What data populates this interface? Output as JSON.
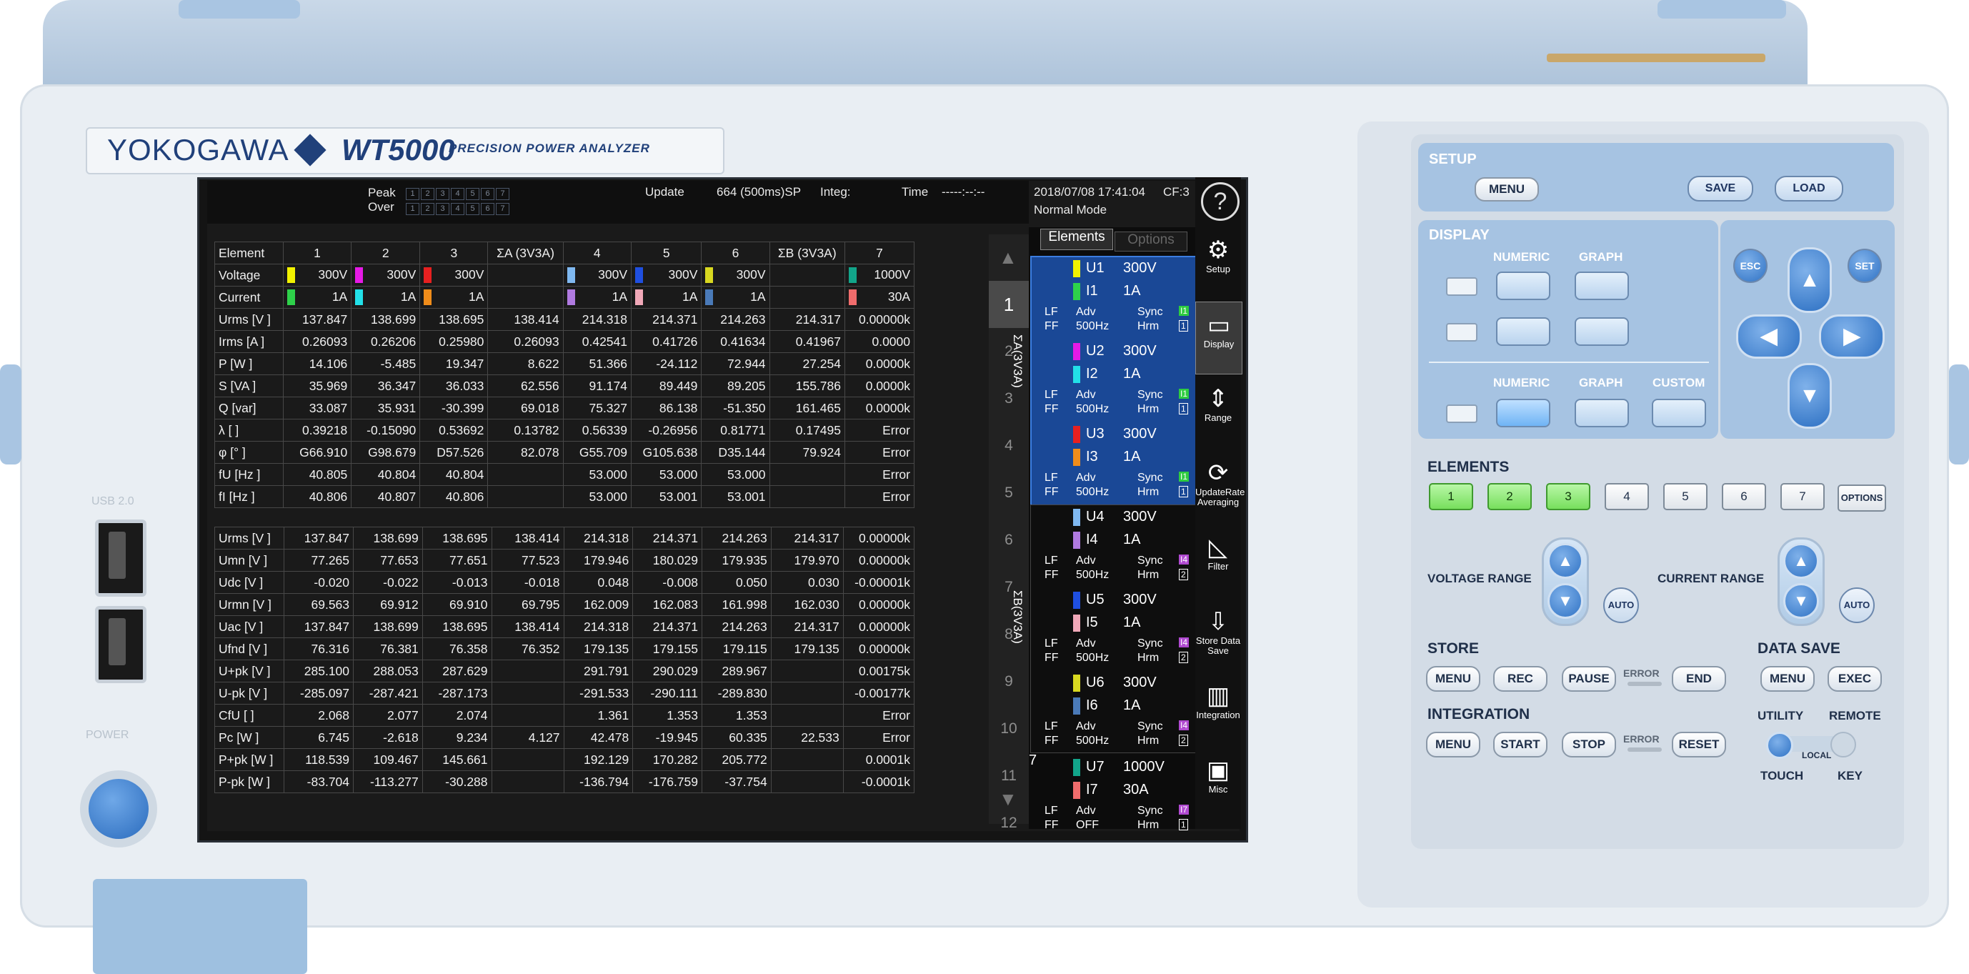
{
  "brand": {
    "maker": "YOKOGAWA",
    "model": "WT5000",
    "subtitle": "PRECISION POWER ANALYZER"
  },
  "header": {
    "peak_label": "Peak",
    "over_label": "Over",
    "peak_cells": "1 2 3 4 5 6 7",
    "update_label": "Update",
    "update_value": "664 (500ms)SP",
    "integ_label": "Integ:",
    "time_label": "Time",
    "time_value": "-----:--:--",
    "datetime": "2018/07/08 17:41:04",
    "cf": "CF:3",
    "mode": "Normal Mode"
  },
  "table_top": {
    "element_header": "Element",
    "columns": [
      "1",
      "2",
      "3",
      "ΣA (3V3A)",
      "4",
      "5",
      "6",
      "ΣB (3V3A)",
      "7"
    ],
    "voltage_label": "Voltage",
    "current_label": "Current",
    "voltage_ranges": [
      "300V",
      "300V",
      "300V",
      "",
      "300V",
      "300V",
      "300V",
      "",
      "1000V"
    ],
    "current_ranges": [
      "1A",
      "1A",
      "1A",
      "",
      "1A",
      "1A",
      "1A",
      "",
      "30A"
    ],
    "rows": [
      {
        "label": "Urms [V ]",
        "values": [
          "137.847",
          "138.699",
          "138.695",
          "138.414",
          "214.318",
          "214.371",
          "214.263",
          "214.317",
          "0.00000k"
        ]
      },
      {
        "label": "Irms [A ]",
        "values": [
          "0.26093",
          "0.26206",
          "0.25980",
          "0.26093",
          "0.42541",
          "0.41726",
          "0.41634",
          "0.41967",
          "0.0000"
        ]
      },
      {
        "label": "P    [W ]",
        "values": [
          "14.106",
          "-5.485",
          "19.347",
          "8.622",
          "51.366",
          "-24.112",
          "72.944",
          "27.254",
          "0.0000k"
        ]
      },
      {
        "label": "S   [VA ]",
        "values": [
          "35.969",
          "36.347",
          "36.033",
          "62.556",
          "91.174",
          "89.449",
          "89.205",
          "155.786",
          "0.0000k"
        ]
      },
      {
        "label": "Q  [var]",
        "values": [
          "33.087",
          "35.931",
          "-30.399",
          "69.018",
          "75.327",
          "86.138",
          "-51.350",
          "161.465",
          "0.0000k"
        ]
      },
      {
        "label": "λ    [  ]",
        "values": [
          "0.39218",
          "-0.15090",
          "0.53692",
          "0.13782",
          "0.56339",
          "-0.26956",
          "0.81771",
          "0.17495",
          "Error"
        ]
      },
      {
        "label": "φ    [° ]",
        "values": [
          "G66.910",
          "G98.679",
          "D57.526",
          "82.078",
          "G55.709",
          "G105.638",
          "D35.144",
          "79.924",
          "Error"
        ]
      },
      {
        "label": "fU  [Hz ]",
        "values": [
          "40.805",
          "40.804",
          "40.804",
          "",
          "53.000",
          "53.000",
          "53.000",
          "",
          "Error"
        ]
      },
      {
        "label": "fI  [Hz ]",
        "values": [
          "40.806",
          "40.807",
          "40.806",
          "",
          "53.000",
          "53.001",
          "53.001",
          "",
          "Error"
        ]
      }
    ]
  },
  "table_bottom": {
    "rows": [
      {
        "label": "Urms [V ]",
        "values": [
          "137.847",
          "138.699",
          "138.695",
          "138.414",
          "214.318",
          "214.371",
          "214.263",
          "214.317",
          "0.00000k"
        ]
      },
      {
        "label": "Umn  [V ]",
        "values": [
          "77.265",
          "77.653",
          "77.651",
          "77.523",
          "179.946",
          "180.029",
          "179.935",
          "179.970",
          "0.00000k"
        ]
      },
      {
        "label": "Udc  [V ]",
        "values": [
          "-0.020",
          "-0.022",
          "-0.013",
          "-0.018",
          "0.048",
          "-0.008",
          "0.050",
          "0.030",
          "-0.00001k"
        ]
      },
      {
        "label": "Urmn [V ]",
        "values": [
          "69.563",
          "69.912",
          "69.910",
          "69.795",
          "162.009",
          "162.083",
          "161.998",
          "162.030",
          "0.00000k"
        ]
      },
      {
        "label": "Uac  [V ]",
        "values": [
          "137.847",
          "138.699",
          "138.695",
          "138.414",
          "214.318",
          "214.371",
          "214.263",
          "214.317",
          "0.00000k"
        ]
      },
      {
        "label": "Ufnd [V ]",
        "values": [
          "76.316",
          "76.381",
          "76.358",
          "76.352",
          "179.135",
          "179.155",
          "179.115",
          "179.135",
          "0.00000k"
        ]
      },
      {
        "label": "U+pk [V ]",
        "values": [
          "285.100",
          "288.053",
          "287.629",
          "",
          "291.791",
          "290.029",
          "289.967",
          "",
          "0.00175k"
        ]
      },
      {
        "label": "U-pk [V ]",
        "values": [
          "-285.097",
          "-287.421",
          "-287.173",
          "",
          "-291.533",
          "-290.111",
          "-289.830",
          "",
          "-0.00177k"
        ]
      },
      {
        "label": "CfU  [  ]",
        "values": [
          "2.068",
          "2.077",
          "2.074",
          "",
          "1.361",
          "1.353",
          "1.353",
          "",
          "Error"
        ]
      },
      {
        "label": "Pc   [W ]",
        "values": [
          "6.745",
          "-2.618",
          "9.234",
          "4.127",
          "42.478",
          "-19.945",
          "60.335",
          "22.533",
          "Error"
        ]
      },
      {
        "label": "P+pk [W ]",
        "values": [
          "118.539",
          "109.467",
          "145.661",
          "",
          "192.129",
          "170.282",
          "205.772",
          "",
          "0.0001k"
        ]
      },
      {
        "label": "P-pk [W ]",
        "values": [
          "-83.704",
          "-113.277",
          "-30.288",
          "",
          "-136.794",
          "-176.759",
          "-37.754",
          "",
          "-0.0001k"
        ]
      }
    ]
  },
  "scroll_list": [
    "1",
    "2",
    "3",
    "4",
    "5",
    "6",
    "7",
    "8",
    "9",
    "10",
    "11",
    "12"
  ],
  "elements_panel": {
    "tab_elements": "Elements",
    "tab_options": "Options",
    "group_a": "ΣA(3V3A)",
    "group_b": "ΣB(3V3A)",
    "items": [
      {
        "u": "U1",
        "ur": "300V",
        "i": "I1",
        "ir": "1A",
        "adv": "Adv",
        "freq": "500Hz",
        "sync": "Sync",
        "hrm": "Hrm",
        "sa": "I1",
        "sb": "1",
        "lf": "LF",
        "ff": "FF",
        "ucolor": "#f2f200",
        "icolor": "#2ed14a"
      },
      {
        "u": "U2",
        "ur": "300V",
        "i": "I2",
        "ir": "1A",
        "adv": "Adv",
        "freq": "500Hz",
        "sync": "Sync",
        "hrm": "Hrm",
        "sa": "I1",
        "sb": "1",
        "lf": "LF",
        "ff": "FF",
        "ucolor": "#e61ae6",
        "icolor": "#22e0e8"
      },
      {
        "u": "U3",
        "ur": "300V",
        "i": "I3",
        "ir": "1A",
        "adv": "Adv",
        "freq": "500Hz",
        "sync": "Sync",
        "hrm": "Hrm",
        "sa": "I1",
        "sb": "1",
        "lf": "LF",
        "ff": "FF",
        "ucolor": "#e62020",
        "icolor": "#f08c1a"
      },
      {
        "u": "U4",
        "ur": "300V",
        "i": "I4",
        "ir": "1A",
        "adv": "Adv",
        "freq": "500Hz",
        "sync": "Sync",
        "hrm": "Hrm",
        "sa": "I4",
        "sb": "2",
        "lf": "LF",
        "ff": "FF",
        "ucolor": "#7fb8f0",
        "icolor": "#b07ae0"
      },
      {
        "u": "U5",
        "ur": "300V",
        "i": "I5",
        "ir": "1A",
        "adv": "Adv",
        "freq": "500Hz",
        "sync": "Sync",
        "hrm": "Hrm",
        "sa": "I4",
        "sb": "2",
        "lf": "LF",
        "ff": "FF",
        "ucolor": "#1f4fe0",
        "icolor": "#f0a8b8"
      },
      {
        "u": "U6",
        "ur": "300V",
        "i": "I6",
        "ir": "1A",
        "adv": "Adv",
        "freq": "500Hz",
        "sync": "Sync",
        "hrm": "Hrm",
        "sa": "I4",
        "sb": "2",
        "lf": "LF",
        "ff": "FF",
        "ucolor": "#d8d820",
        "icolor": "#4a7ab8"
      },
      {
        "u": "U7",
        "ur": "1000V",
        "i": "I7",
        "ir": "30A",
        "adv": "Adv",
        "freq": "OFF",
        "sync": "Sync",
        "hrm": "Hrm",
        "sa": "I7",
        "sb": "1",
        "lf": "LF",
        "ff": "FF",
        "ucolor": "#12a58a",
        "icolor": "#f06c6c"
      }
    ],
    "row7_label": "7"
  },
  "side_menu": [
    {
      "label": "",
      "icon": "help-icon"
    },
    {
      "label": "Setup",
      "icon": "gear-icon"
    },
    {
      "label": "Display",
      "icon": "display-icon"
    },
    {
      "label": "Range",
      "icon": "range-icon"
    },
    {
      "label": "UpdateRate Averaging",
      "icon": "refresh-icon"
    },
    {
      "label": "Filter",
      "icon": "filter-icon"
    },
    {
      "label": "Store Data Save",
      "icon": "store-icon"
    },
    {
      "label": "Integration",
      "icon": "integration-icon"
    },
    {
      "label": "Misc",
      "icon": "toolbox-icon"
    }
  ],
  "controls": {
    "setup": {
      "title": "SETUP",
      "menu": "MENU",
      "save": "SAVE",
      "load": "LOAD"
    },
    "display": {
      "title": "DISPLAY",
      "numeric": "NUMERIC",
      "graph": "GRAPH",
      "numeric2": "NUMERIC",
      "graph2": "GRAPH",
      "custom": "CUSTOM"
    },
    "nav": {
      "esc": "ESC",
      "set": "SET"
    },
    "elements": {
      "title": "ELEMENTS",
      "buttons": [
        "1",
        "2",
        "3",
        "4",
        "5",
        "6",
        "7"
      ],
      "options": "OPTIONS"
    },
    "voltage_range": "VOLTAGE RANGE",
    "current_range": "CURRENT RANGE",
    "auto": "AUTO",
    "store": {
      "title": "STORE",
      "menu": "MENU",
      "rec": "REC",
      "pause": "PAUSE",
      "error": "ERROR",
      "end": "END"
    },
    "data_save": {
      "title": "DATA SAVE",
      "menu": "MENU",
      "exec": "EXEC"
    },
    "integration": {
      "title": "INTEGRATION",
      "menu": "MENU",
      "start": "START",
      "stop": "STOP",
      "error": "ERROR",
      "reset": "RESET"
    },
    "utility": "UTILITY",
    "remote": "REMOTE",
    "local": "LOCAL",
    "touch": "TOUCH",
    "key": "KEY"
  },
  "left": {
    "usb_label": "USB 2.0",
    "power_label": "POWER"
  }
}
